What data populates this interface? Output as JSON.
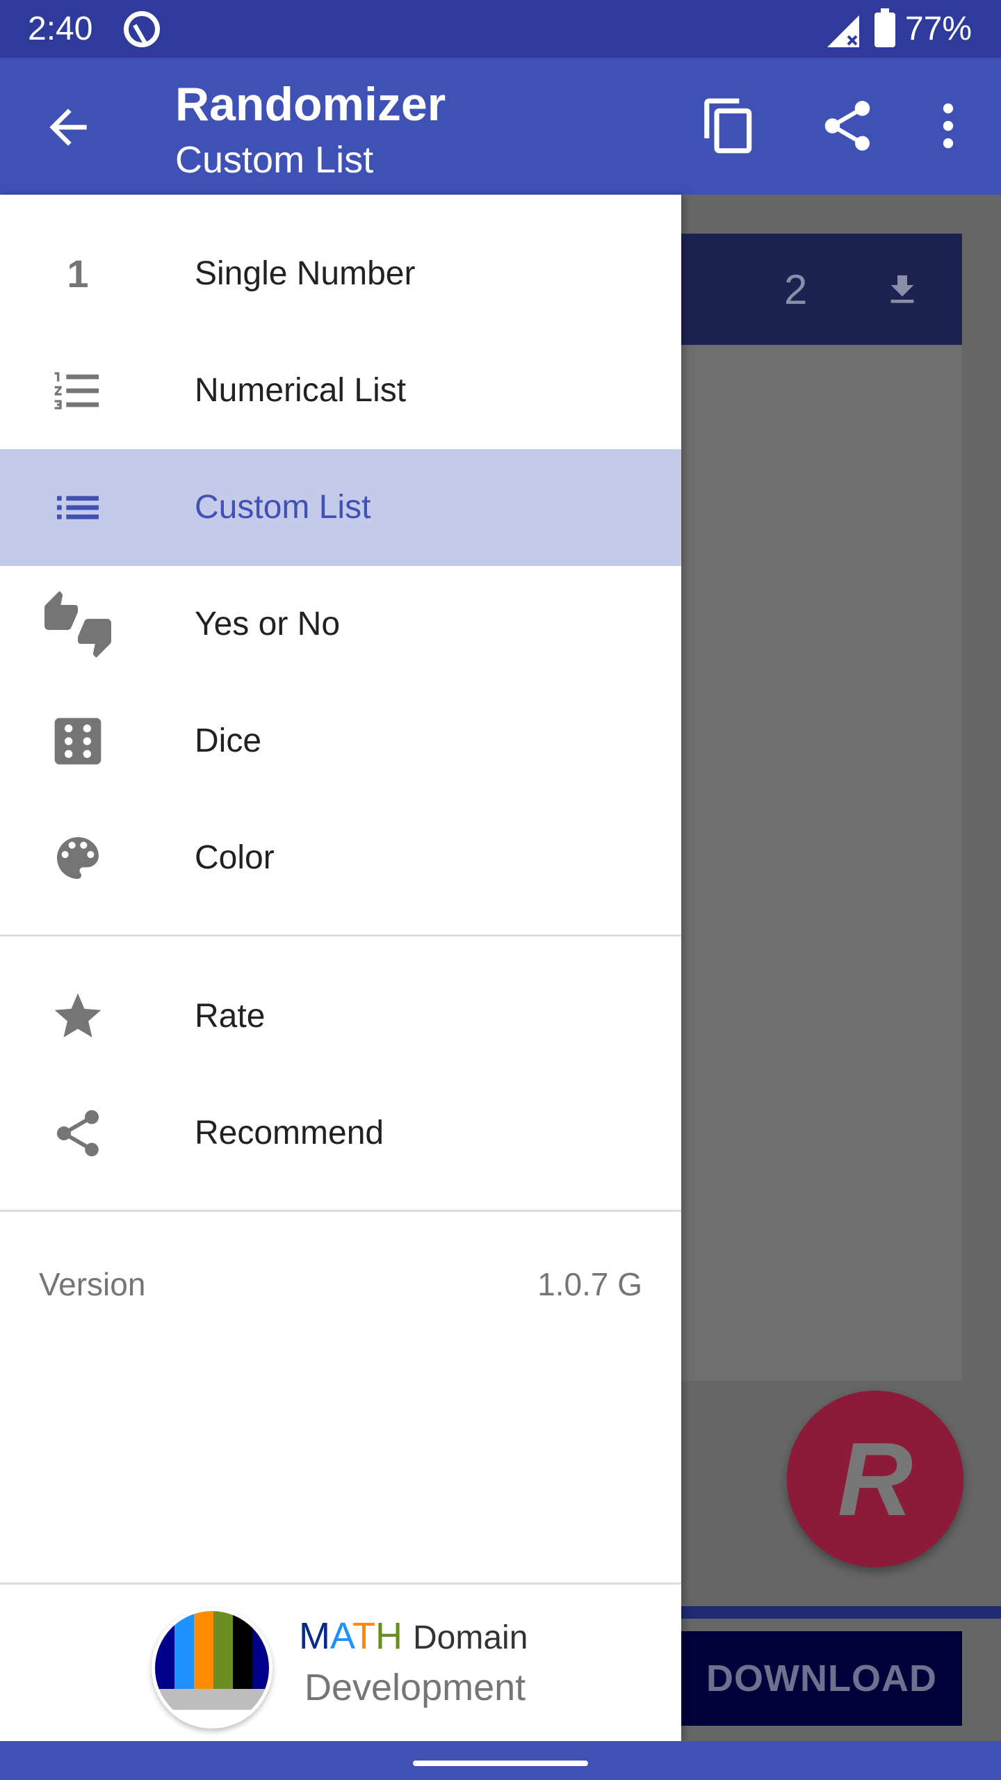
{
  "status_bar": {
    "time": "2:40",
    "battery": "77%"
  },
  "app_bar": {
    "title": "Randomizer",
    "subtitle": "Custom List"
  },
  "background": {
    "count": "2",
    "download_label": "DOWNLOAD",
    "fab_letter": "R"
  },
  "drawer": {
    "items": [
      {
        "label": "Single Number",
        "icon": "number-one-icon",
        "icon_text": "1"
      },
      {
        "label": "Numerical List",
        "icon": "numbered-list-icon"
      },
      {
        "label": "Custom List",
        "icon": "bulleted-list-icon",
        "selected": true
      },
      {
        "label": "Yes or No",
        "icon": "thumbs-up-down-icon"
      },
      {
        "label": "Dice",
        "icon": "dice-icon"
      },
      {
        "label": "Color",
        "icon": "palette-icon"
      }
    ],
    "secondary": [
      {
        "label": "Rate",
        "icon": "star-icon"
      },
      {
        "label": "Recommend",
        "icon": "share-icon"
      }
    ],
    "version_label": "Version",
    "version_value": "1.0.7 G",
    "footer": {
      "m": "M",
      "a": "A",
      "t": "T",
      "h": "H",
      "domain": "Domain",
      "development": "Development"
    }
  },
  "colors": {
    "primary": "#3f51b5",
    "primary_dark": "#2f3b9b",
    "selected_bg": "#c5cae9",
    "fab": "#8e1a3a"
  }
}
